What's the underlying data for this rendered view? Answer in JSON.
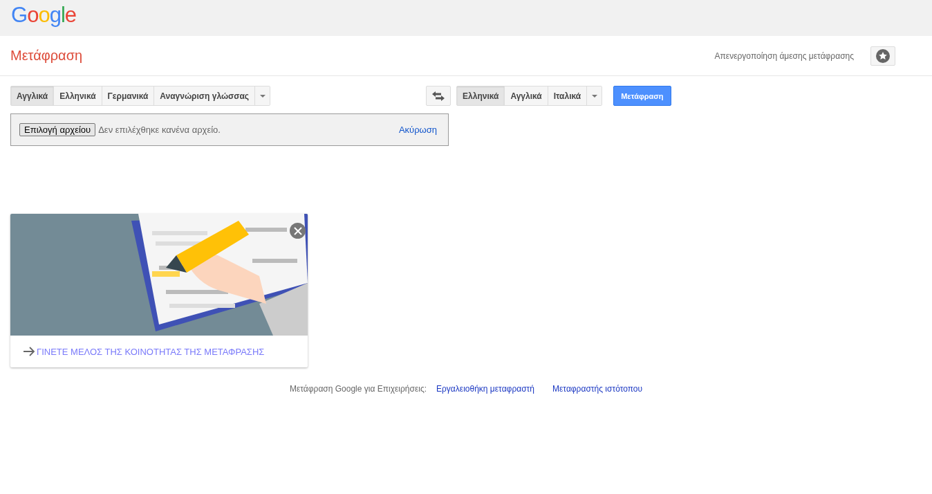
{
  "logo": "Google",
  "title": "Μετάφραση",
  "instant_toggle": "Απενεργοποίηση άμεσης μετάφρασης",
  "source_languages": [
    {
      "label": "Αγγλικά",
      "selected": true
    },
    {
      "label": "Ελληνικά",
      "selected": false
    },
    {
      "label": "Γερμανικά",
      "selected": false
    },
    {
      "label": "Αναγνώριση γλώσσας",
      "selected": false
    }
  ],
  "target_languages": [
    {
      "label": "Ελληνικά",
      "selected": true
    },
    {
      "label": "Αγγλικά",
      "selected": false
    },
    {
      "label": "Ιταλικά",
      "selected": false
    }
  ],
  "translate_button": "Μετάφραση",
  "file_upload": {
    "button": "Επιλογή αρχείου",
    "status": "Δεν επιλέχθηκε κανένα αρχείο.",
    "cancel": "Ακύρωση"
  },
  "community_card": {
    "link": "ΓΙΝΕΤΕ ΜΕΛΟΣ ΤΗΣ ΚΟΙΝΟΤΗΤΑΣ ΤΗΣ ΜΕΤΑΦΡΑΣΗΣ"
  },
  "footer": {
    "label": "Μετάφραση Google για Επιχειρήσεις:",
    "links": [
      "Εργαλειοθήκη μεταφραστή",
      "Μεταφραστής ιστότοπου"
    ]
  }
}
